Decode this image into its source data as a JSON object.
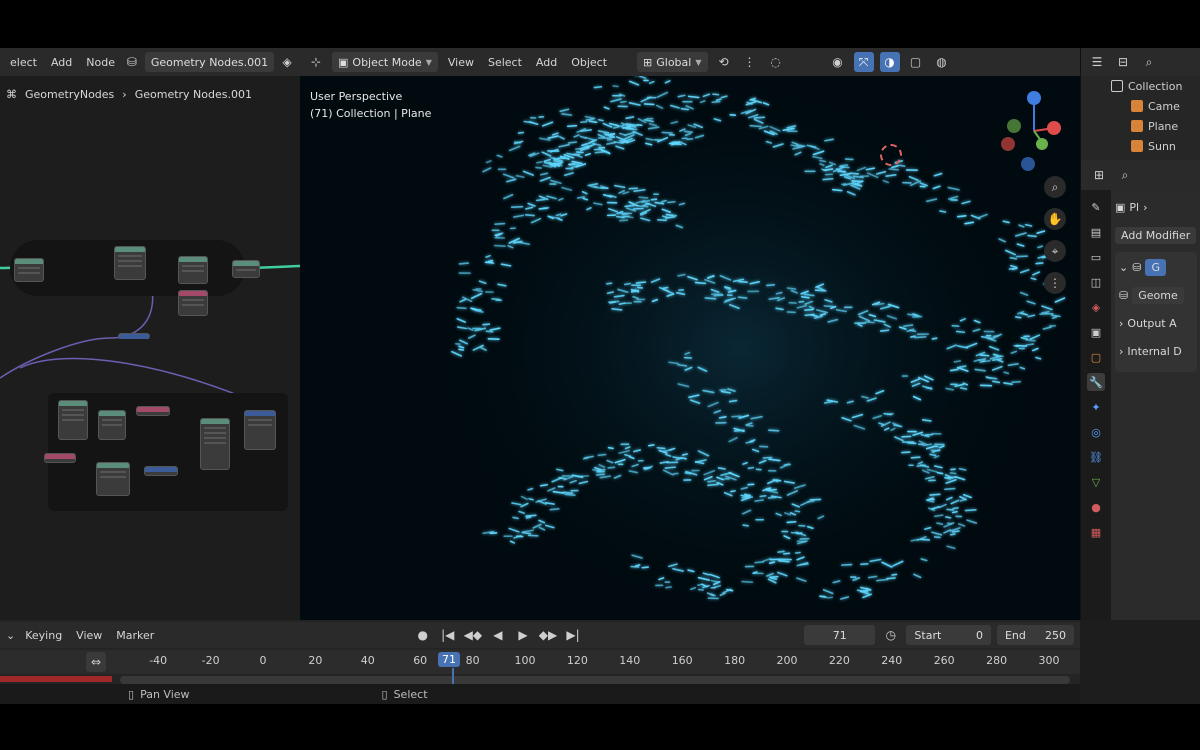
{
  "node_editor": {
    "menu": [
      "elect",
      "Add",
      "Node"
    ],
    "node_group_name": "Geometry Nodes.001",
    "breadcrumb": [
      "GeometryNodes",
      "Geometry Nodes.001"
    ]
  },
  "viewport": {
    "mode": "Object Mode",
    "menu": [
      "View",
      "Select",
      "Add",
      "Object"
    ],
    "orientation": "Global",
    "overlay_line1": "User Perspective",
    "overlay_line2": "(71) Collection | Plane",
    "particle_color": "#5fd8ff"
  },
  "outliner": {
    "items": [
      {
        "label": "Collection",
        "icon_color": "#d9d9d9"
      },
      {
        "label": "Came",
        "icon_color": "#d8833a"
      },
      {
        "label": "Plane",
        "icon_color": "#d8833a"
      },
      {
        "label": "Sunn",
        "icon_color": "#d8833a"
      }
    ]
  },
  "properties": {
    "object_name": "Pl",
    "add_modifier": "Add Modifier",
    "modifier_name": "G",
    "node_group": "Geome",
    "output_attributes": "Output A",
    "internal_dependencies": "Internal D",
    "tab_icons": [
      "tool-icon",
      "render-icon",
      "output-icon",
      "view-layer-icon",
      "scene-icon",
      "world-icon",
      "object-icon",
      "modifier-icon",
      "particles-icon",
      "physics-icon",
      "constraints-icon",
      "data-icon",
      "material-icon",
      "texture-icon"
    ]
  },
  "timeline": {
    "menu": [
      "Keying",
      "View",
      "Marker"
    ],
    "current_frame": "71",
    "start_label": "Start",
    "start_value": "0",
    "end_label": "End",
    "end_value": "250",
    "ruler_ticks": [
      "-40",
      "-20",
      "0",
      "20",
      "40",
      "60",
      "71",
      "80",
      "100",
      "120",
      "140",
      "160",
      "180",
      "200",
      "220",
      "240",
      "260",
      "280",
      "300"
    ]
  },
  "statusbar": {
    "pan_view": "Pan View",
    "select": "Select"
  },
  "colors": {
    "accent": "#4772b3",
    "gizmo_x": "#e04b4b",
    "gizmo_y": "#6ab04c",
    "gizmo_z": "#3f7ee0"
  }
}
